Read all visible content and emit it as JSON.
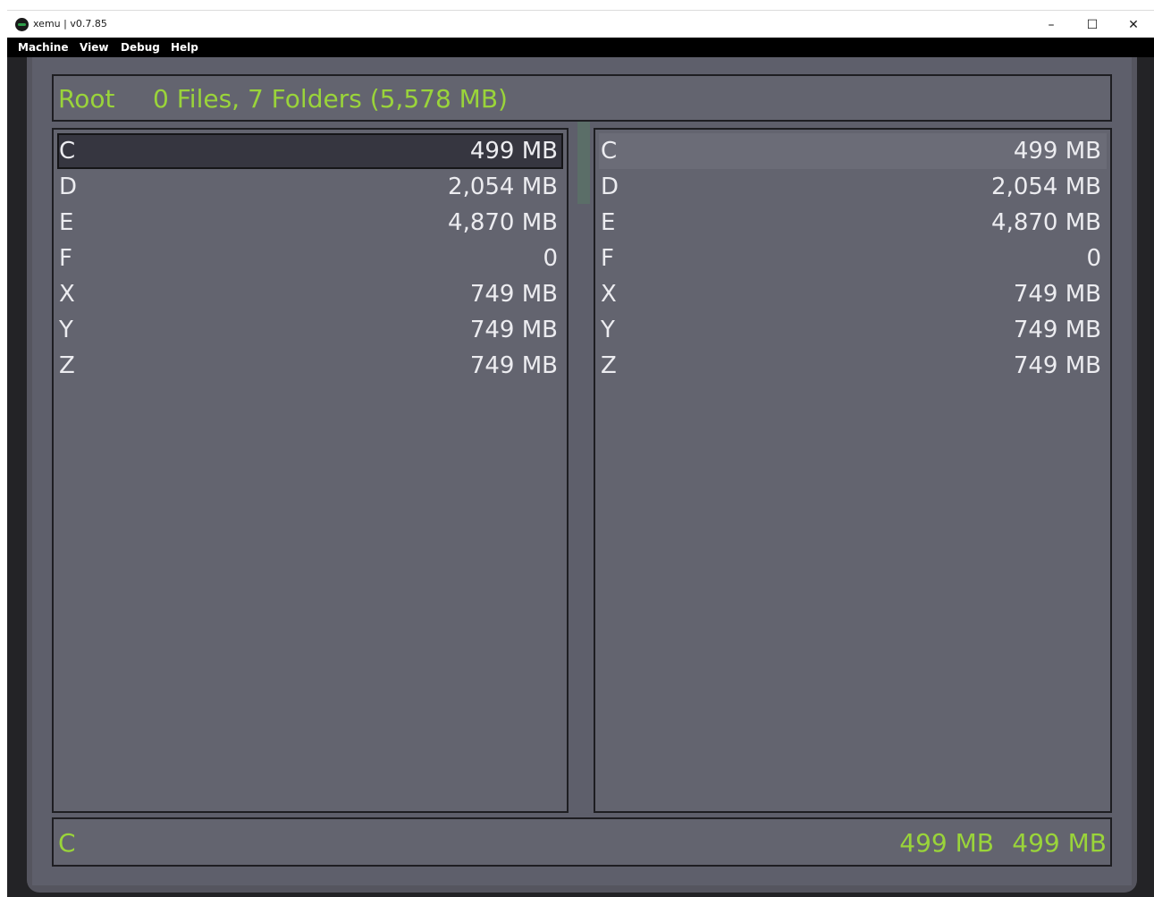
{
  "window": {
    "title": "xemu | v0.7.85",
    "minimize_glyph": "–",
    "maximize_glyph": "☐",
    "close_glyph": "✕"
  },
  "menubar": {
    "items": [
      {
        "label": "Machine"
      },
      {
        "label": "View"
      },
      {
        "label": "Debug"
      },
      {
        "label": "Help"
      }
    ]
  },
  "header": {
    "location": "Root",
    "summary": "0 Files, 7 Folders (5,578 MB)"
  },
  "left_pane": {
    "rows": [
      {
        "name": "C",
        "size": "499 MB"
      },
      {
        "name": "D",
        "size": "2,054 MB"
      },
      {
        "name": "E",
        "size": "4,870 MB"
      },
      {
        "name": "F",
        "size": "0"
      },
      {
        "name": "X",
        "size": "749 MB"
      },
      {
        "name": "Y",
        "size": "749 MB"
      },
      {
        "name": "Z",
        "size": "749 MB"
      }
    ]
  },
  "right_pane": {
    "rows": [
      {
        "name": "C",
        "size": "499 MB"
      },
      {
        "name": "D",
        "size": "2,054 MB"
      },
      {
        "name": "E",
        "size": "4,870 MB"
      },
      {
        "name": "F",
        "size": "0"
      },
      {
        "name": "X",
        "size": "749 MB"
      },
      {
        "name": "Y",
        "size": "749 MB"
      },
      {
        "name": "Z",
        "size": "749 MB"
      }
    ]
  },
  "footer": {
    "name": "C",
    "size_a": "499 MB",
    "size_b": "499 MB"
  },
  "colors": {
    "accent_text": "#9ad43a",
    "row_text": "#ececf0",
    "panel_bg": "#63646f"
  }
}
